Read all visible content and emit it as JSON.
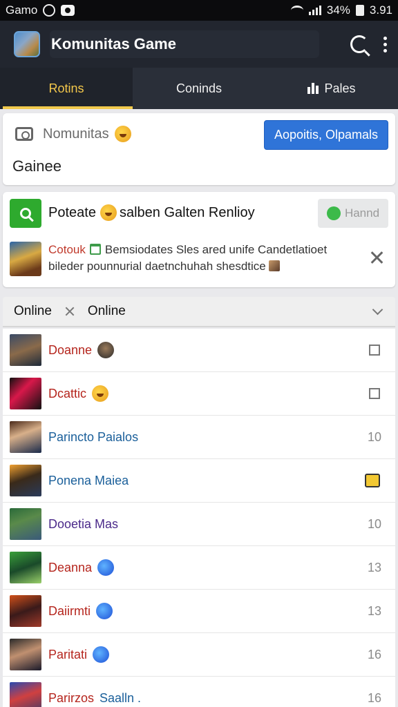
{
  "status_bar": {
    "app_label": "Gamo",
    "battery": "34%",
    "time": "3.91"
  },
  "app_bar": {
    "title": "Komunitas Game"
  },
  "tabs": [
    {
      "label": "Rotins",
      "active": true
    },
    {
      "label": "Coninds",
      "active": false
    },
    {
      "label": "Pales",
      "active": false
    }
  ],
  "community_card": {
    "label": "Nomunitas",
    "button_label": "Aopoitis, Olpamals",
    "value": "Gainee"
  },
  "news_card": {
    "headline_a": "Poteate",
    "headline_b": "salben Galten Renlioy",
    "button_label": "Hannd",
    "source": "Cotouk",
    "line1": "Bemsiodates Sles ared unife Candetlatioet",
    "line2": "bileder pounnurial  daetnchuhah shesdtice"
  },
  "filter": {
    "left": "Online",
    "right": "Online"
  },
  "list": [
    {
      "name": "Doanne",
      "value": "",
      "name_color": "#b5251d",
      "avatar": "linear-gradient(160deg,#3a4a66,#8a6a4a 50%,#1e2a3a)",
      "badge": "mini-avatar",
      "right": "checkbox"
    },
    {
      "name": "Dcattic",
      "value": "",
      "name_color": "#b5251d",
      "avatar": "linear-gradient(135deg,#111,#d8184a 40%,#111)",
      "badge": "emoji",
      "right": "checkbox"
    },
    {
      "name": "Parincto Paialos",
      "value": "10",
      "name_color": "#1a5f9a",
      "avatar": "linear-gradient(160deg,#4a2a1a,#d8b08a 40%,#1a2a4a)",
      "badge": "",
      "right": "value"
    },
    {
      "name": "Ponena Maiea",
      "value": "",
      "name_color": "#1a5f9a",
      "avatar": "linear-gradient(160deg,#f0a030,#3a2a1a 45%,#2a3a5a)",
      "badge": "",
      "right": "yellow-badge"
    },
    {
      "name": "Dooetia Mas",
      "value": "10",
      "name_color": "#4b2a8a",
      "avatar": "linear-gradient(160deg,#2a6a3a,#5a8a4a 40%,#3a5a7a)",
      "badge": "",
      "right": "value"
    },
    {
      "name": "Deanna",
      "value": "13",
      "name_color": "#b5251d",
      "avatar": "linear-gradient(160deg,#3aa03a,#1a4a2a 50%,#9ad06a)",
      "badge": "blue-badge",
      "right": "value"
    },
    {
      "name": "Daiirmti",
      "value": "13",
      "name_color": "#b5251d",
      "avatar": "linear-gradient(160deg,#d0501a,#3a1a1a 50%,#a03a2a)",
      "badge": "blue-badge",
      "right": "value"
    },
    {
      "name": "Paritati",
      "value": "16",
      "name_color": "#b5251d",
      "avatar": "linear-gradient(160deg,#2a2a2a,#c09070 45%,#1a1a2a)",
      "badge": "blue-badge",
      "right": "value"
    },
    {
      "name": "Parirzos",
      "name_b": "Saalln .",
      "value": "16",
      "name_color": "#b5251d",
      "avatar": "linear-gradient(160deg,#2a4ab0,#d04040 45%,#3a3a6a)",
      "badge": "",
      "right": "value"
    }
  ]
}
